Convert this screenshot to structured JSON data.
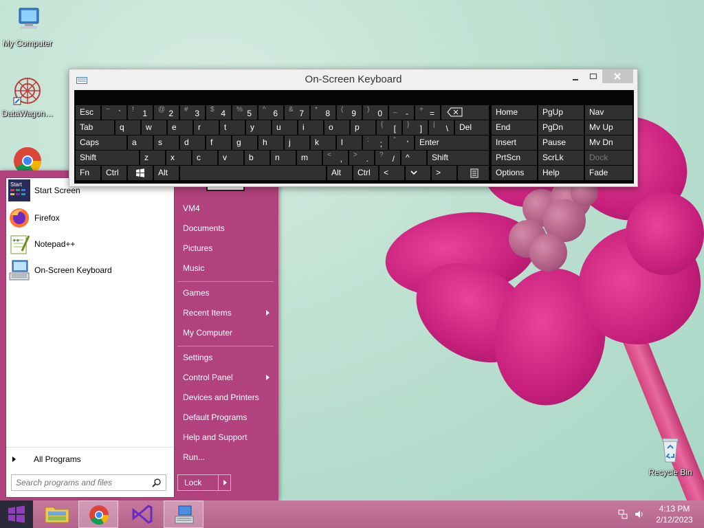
{
  "desktop": {
    "icons": [
      {
        "label": "My Computer"
      },
      {
        "label": "DataWagon…"
      },
      {
        "label": "Recycle Bin"
      }
    ]
  },
  "osk": {
    "title": "On-Screen Keyboard",
    "rows": {
      "r1": [
        {
          "k": "Esc"
        },
        {
          "s": "~",
          "m": "`"
        },
        {
          "s": "!",
          "m": "1"
        },
        {
          "s": "@",
          "m": "2"
        },
        {
          "s": "#",
          "m": "3"
        },
        {
          "s": "$",
          "m": "4"
        },
        {
          "s": "%",
          "m": "5"
        },
        {
          "s": "^",
          "m": "6"
        },
        {
          "s": "&",
          "m": "7"
        },
        {
          "s": "*",
          "m": "8"
        },
        {
          "s": "(",
          "m": "9"
        },
        {
          "s": ")",
          "m": "0"
        },
        {
          "s": "_",
          "m": "-"
        },
        {
          "s": "+",
          "m": "="
        }
      ],
      "r2": [
        {
          "k": "Tab"
        },
        {
          "k": "q"
        },
        {
          "k": "w"
        },
        {
          "k": "e"
        },
        {
          "k": "r"
        },
        {
          "k": "t"
        },
        {
          "k": "y"
        },
        {
          "k": "u"
        },
        {
          "k": "i"
        },
        {
          "k": "o"
        },
        {
          "k": "p"
        },
        {
          "s": "{",
          "m": "["
        },
        {
          "s": "}",
          "m": "]"
        },
        {
          "s": "|",
          "m": "\\"
        },
        {
          "k": "Del"
        }
      ],
      "r3": [
        {
          "k": "Caps"
        },
        {
          "k": "a"
        },
        {
          "k": "s"
        },
        {
          "k": "d"
        },
        {
          "k": "f"
        },
        {
          "k": "g"
        },
        {
          "k": "h"
        },
        {
          "k": "j"
        },
        {
          "k": "k"
        },
        {
          "k": "l"
        },
        {
          "s": ":",
          "m": ";"
        },
        {
          "s": "\"",
          "m": "'"
        },
        {
          "k": "Enter"
        }
      ],
      "r4": [
        {
          "k": "Shift"
        },
        {
          "k": "z"
        },
        {
          "k": "x"
        },
        {
          "k": "c"
        },
        {
          "k": "v"
        },
        {
          "k": "b"
        },
        {
          "k": "n"
        },
        {
          "k": "m"
        },
        {
          "s": "<",
          "m": ","
        },
        {
          "s": ">",
          "m": "."
        },
        {
          "s": "?",
          "m": "/"
        },
        {
          "k": "^"
        },
        {
          "k": "Shift"
        }
      ],
      "r5": [
        {
          "k": "Fn"
        },
        {
          "k": "Ctrl"
        },
        {
          "k": "Alt"
        },
        {
          "k": "Alt"
        },
        {
          "k": "Ctrl"
        },
        {
          "k": "<"
        },
        {
          "k": ">"
        }
      ],
      "nav": [
        [
          "Home",
          "PgUp",
          "Nav"
        ],
        [
          "End",
          "PgDn",
          "Mv Up"
        ],
        [
          "Insert",
          "Pause",
          "Mv Dn"
        ],
        [
          "PrtScn",
          "ScrLk",
          "Dock"
        ],
        [
          "Options",
          "Help",
          "Fade"
        ]
      ]
    }
  },
  "startmenu": {
    "programs": [
      {
        "label": "Start Screen",
        "icon": "start-screen-icon"
      },
      {
        "label": "Firefox",
        "icon": "firefox-icon"
      },
      {
        "label": "Notepad++",
        "icon": "notepad-plus-plus-icon"
      },
      {
        "label": "On-Screen Keyboard",
        "icon": "keyboard-icon"
      }
    ],
    "all_programs": "All Programs",
    "search_placeholder": "Search programs and files",
    "right": {
      "vm4": "VM4",
      "documents": "Documents",
      "pictures": "Pictures",
      "music": "Music",
      "games": "Games",
      "recent": "Recent Items",
      "mycomputer": "My Computer",
      "settings": "Settings",
      "controlpanel": "Control Panel",
      "devices": "Devices and Printers",
      "defaultprograms": "Default Programs",
      "help": "Help and Support",
      "run": "Run..."
    },
    "lock": "Lock"
  },
  "taskbar": {
    "time": "4:13 PM",
    "date": "2/12/2023"
  },
  "colors": {
    "startmenu_bg": "#b1427d",
    "osk_key": "#303030",
    "taskbar": "#b4648c"
  }
}
